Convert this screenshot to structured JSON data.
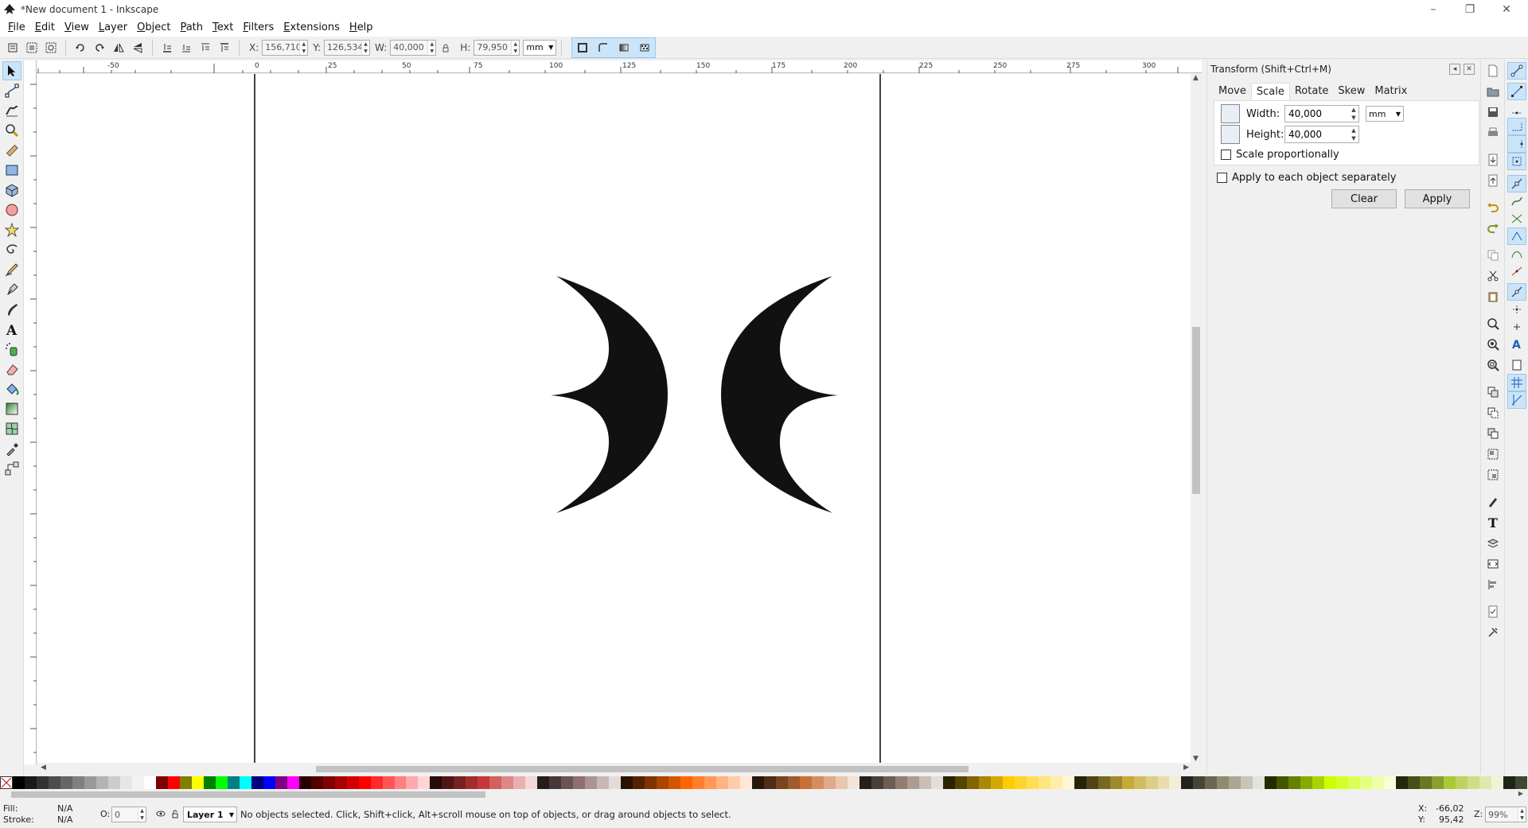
{
  "window": {
    "title": "*New document 1 - Inkscape",
    "controls": [
      "–",
      "❐",
      "✕"
    ]
  },
  "menubar": {
    "items": [
      "File",
      "Edit",
      "View",
      "Layer",
      "Object",
      "Path",
      "Text",
      "Filters",
      "Extensions",
      "Help"
    ]
  },
  "tool_controls": {
    "x_label": "X:",
    "x_value": "156,710",
    "y_label": "Y:",
    "y_value": "126,534",
    "w_label": "W:",
    "w_value": "40,000",
    "h_label": "H:",
    "h_value": "79,950",
    "unit": "mm"
  },
  "ruler": {
    "top_labels": [
      "-50",
      "0",
      "25",
      "50",
      "75",
      "100",
      "125",
      "150",
      "175",
      "200",
      "225",
      "250",
      "275",
      "300"
    ]
  },
  "dock": {
    "title": "Transform (Shift+Ctrl+M)",
    "tabs": [
      "Move",
      "Scale",
      "Rotate",
      "Skew",
      "Matrix"
    ],
    "active_tab": "Scale",
    "width_label": "Width:",
    "width_value": "40,000",
    "height_label": "Height:",
    "height_value": "40,000",
    "unit": "mm",
    "scale_proportionally": "Scale proportionally",
    "apply_each": "Apply to each object separately",
    "clear_label": "Clear",
    "apply_label": "Apply"
  },
  "statusbar": {
    "fill_label": "Fill:",
    "fill_value": "N/A",
    "stroke_label": "Stroke:",
    "stroke_value": "N/A",
    "opacity_label": "O:",
    "opacity_value": "0",
    "layer": "Layer 1",
    "message": "No objects selected. Click, Shift+click, Alt+scroll mouse on top of objects, or drag around objects to select.",
    "x_label": "X:",
    "x_value": "-66,02",
    "y_label": "Y:",
    "y_value": "95,42",
    "zoom_label": "Z:",
    "zoom_value": "99%"
  },
  "palette": {
    "colors": [
      "#000000",
      "#1a1a1a",
      "#333333",
      "#4d4d4d",
      "#666666",
      "#808080",
      "#999999",
      "#b3b3b3",
      "#cccccc",
      "#e6e6e6",
      "#f2f2f2",
      "#ffffff",
      "#800000",
      "#ff0000",
      "#808000",
      "#ffff00",
      "#008000",
      "#00ff00",
      "#008080",
      "#00ffff",
      "#000080",
      "#0000ff",
      "#800080",
      "#ff00ff",
      "#2b0000",
      "#550000",
      "#800000",
      "#aa0000",
      "#d40000",
      "#ff0000",
      "#ff2a2a",
      "#ff5555",
      "#ff8080",
      "#ffaaaa",
      "#ffd5d5",
      "#280b0b",
      "#501616",
      "#782121",
      "#a02c2c",
      "#c83737",
      "#d35f5f",
      "#de8787",
      "#e9afaf",
      "#f4d7d7",
      "#241c1c",
      "#483737",
      "#6c5353",
      "#916f6f",
      "#ac9393",
      "#c8b7b7",
      "#e3dbdb",
      "#2b1100",
      "#552200",
      "#803300",
      "#aa4400",
      "#d45500",
      "#ff6600",
      "#ff7f2a",
      "#ff9955",
      "#ffb380",
      "#ffccaa",
      "#ffe6d5",
      "#28170b",
      "#502d16",
      "#784421",
      "#a05a2c",
      "#c87137",
      "#d38d5f",
      "#deaa87",
      "#e9c6af",
      "#f4e3d7",
      "#241f1c",
      "#483e37",
      "#6c5d53",
      "#917c6f",
      "#ac9d93",
      "#c8beb7",
      "#e3dedb",
      "#2b2200",
      "#554400",
      "#806600",
      "#aa8800",
      "#d4aa00",
      "#ffcc00",
      "#ffd42a",
      "#ffdd55",
      "#ffe680",
      "#ffeeaa",
      "#fff6d5",
      "#28220b",
      "#504416",
      "#786721",
      "#a0892c",
      "#c8ab37",
      "#d3bc5f",
      "#decd87",
      "#e9ddaf",
      "#f4eed7",
      "#24221c",
      "#484537",
      "#6c6753",
      "#918a6f",
      "#aca793",
      "#c8c4b7",
      "#e3e2db",
      "#222b00",
      "#445500",
      "#668000",
      "#88aa00",
      "#aad400",
      "#ccff00",
      "#d4ff2a",
      "#ddff55",
      "#e5ff80",
      "#eeffaa",
      "#f6ffd5",
      "#22280b",
      "#445016",
      "#677821",
      "#89a02c",
      "#abc837",
      "#bcd35f",
      "#cdde87",
      "#dde9af",
      "#eef4d7",
      "#1e2418",
      "#3c4830"
    ]
  }
}
